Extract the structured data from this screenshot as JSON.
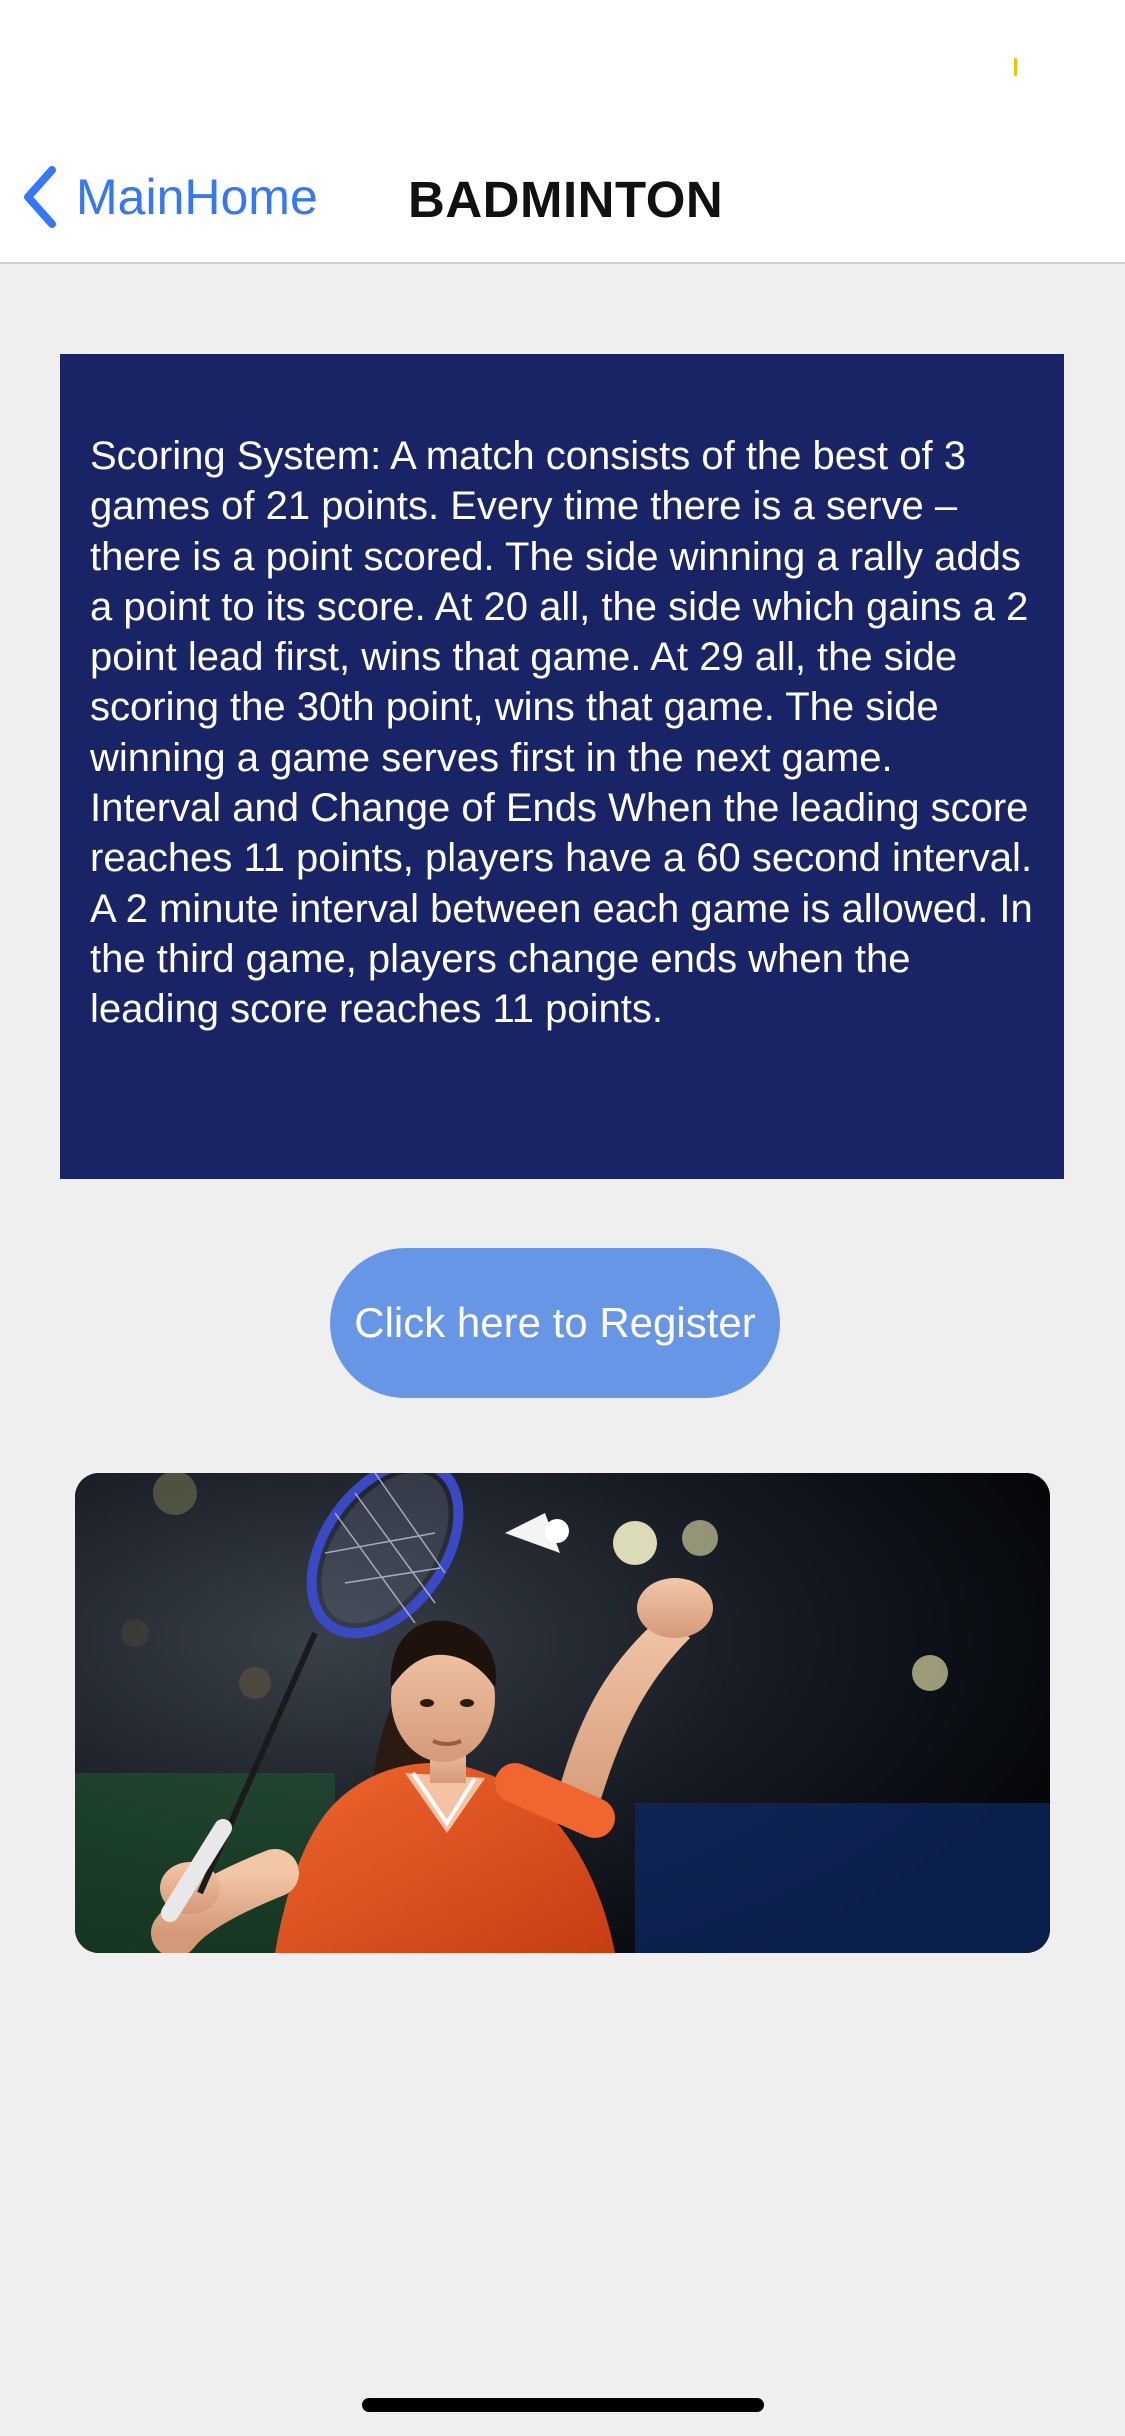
{
  "nav": {
    "back_label": "MainHome",
    "title": "BADMINTON"
  },
  "info": {
    "text": "Scoring System: A match consists of the best of 3 games of 21 points. Every time there is a serve – there is a point scored. The side winning a rally adds a point to its score. At 20 all, the side which gains a 2 point lead first, wins that game. At 29 all, the side scoring the 30th point, wins that game. The side winning a game serves first in the next game. Interval and Change of Ends When the leading score reaches 11 points, players have a 60 second interval. A 2 minute interval between each game is allowed. In the third game, players change ends when the leading score reaches 11 points."
  },
  "register": {
    "label": "Click here to Register"
  },
  "colors": {
    "accent": "#3478f6",
    "card_background": "#192467",
    "button_background": "#6896e6",
    "page_background": "#efefef"
  },
  "icons": {
    "back": "chevron-left-icon"
  }
}
